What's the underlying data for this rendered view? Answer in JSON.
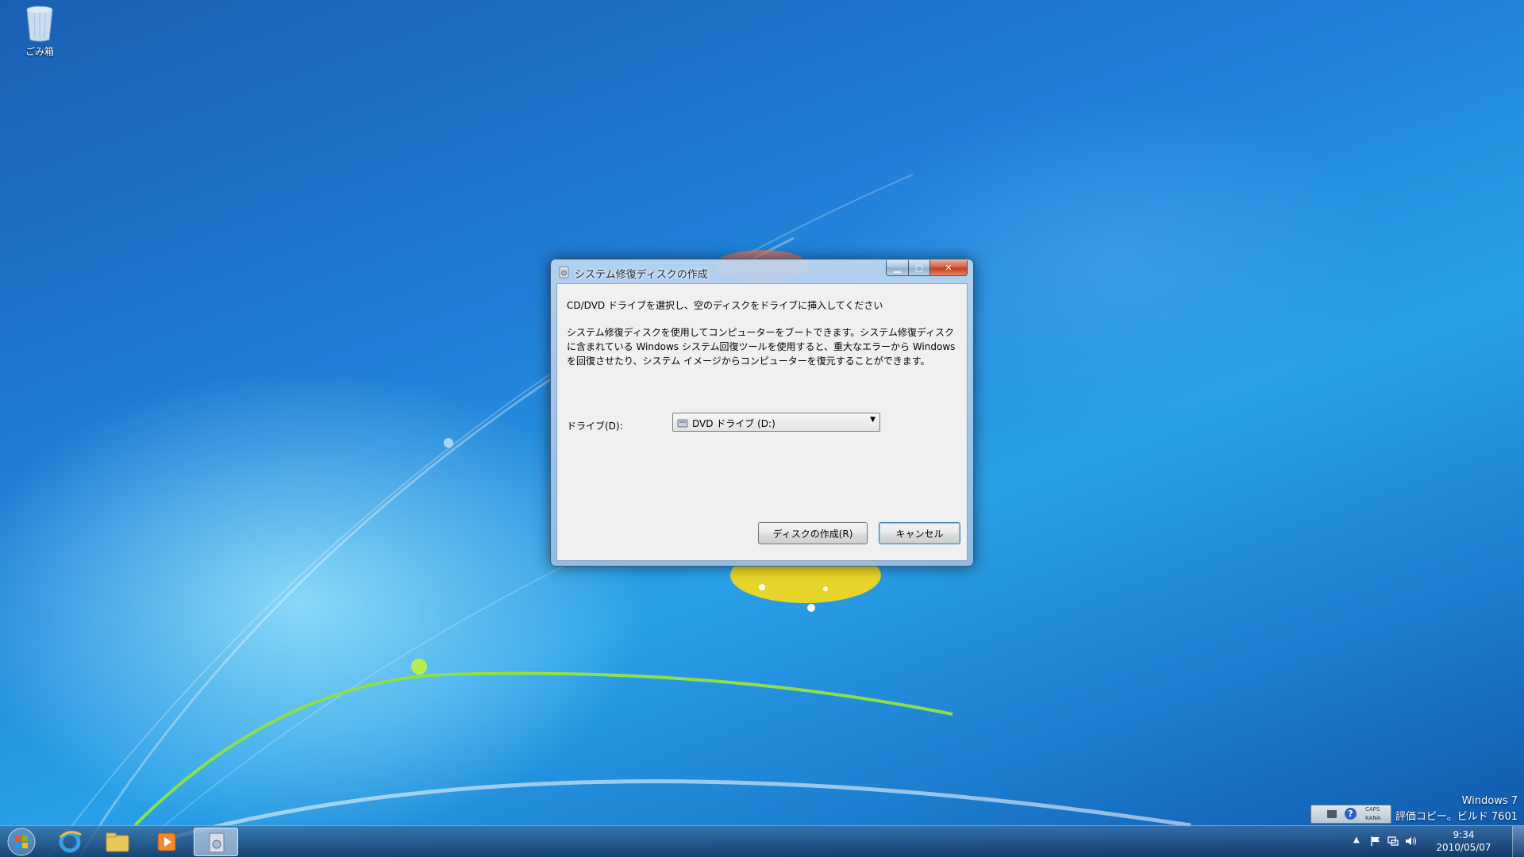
{
  "desktop": {
    "recycle_bin_label": "ごみ箱",
    "watermark": {
      "line1": "Windows 7",
      "line2": "評価コピー。ビルド 7601"
    }
  },
  "window": {
    "title": "システム修復ディスクの作成",
    "minimize_glyph": "▁",
    "maximize_glyph": "□",
    "close_glyph": "✕",
    "instruction": "CD/DVD ドライブを選択し、空のディスクをドライブに挿入してください",
    "description": "システム修復ディスクを使用してコンピューターをブートできます。システム修復ディスクに含まれている Windows システム回復ツールを使用すると、重大なエラーから Windows を回復させたり、システム イメージからコンピューターを復元することができます。",
    "drive_label": "ドライブ(D):",
    "drive_selected": "DVD ドライブ (D:)",
    "dropdown_glyph": "▼",
    "create_button": "ディスクの作成(R)",
    "cancel_button": "キャンセル"
  },
  "language_bar": {
    "help_glyph": "?",
    "caps": "CAPS",
    "kana": "KANA"
  },
  "taskbar": {
    "tray_up_glyph": "▲",
    "clock_time": "9:34",
    "clock_date": "2010/05/07"
  },
  "colors": {
    "desktop_blue": "#1f7fd6",
    "accent_cancel_border": "#3c7fb1",
    "close_red": "#c23a1c"
  }
}
